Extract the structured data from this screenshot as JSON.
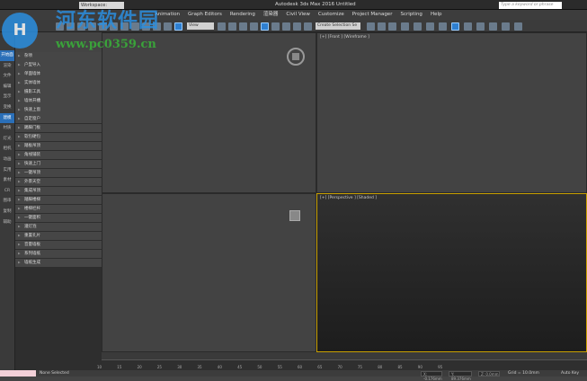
{
  "titlebar": {
    "workspace": "Workspace: Default",
    "title": "Autodesk 3ds Max 2016    Untitled",
    "search_placeholder": "Type a keyword or phrase"
  },
  "menu": [
    "Animation",
    "Graph Editors",
    "Rendering",
    "渲染器",
    "Civil View",
    "Customize",
    "Project Manager",
    "Scripting",
    "Help"
  ],
  "toolbar": {
    "view_dropdown": "View",
    "selection_set": "Create Selection Se"
  },
  "watermark": {
    "name": "河东软件园",
    "url": "www.pc0359.cn"
  },
  "vtabs": [
    "开始面",
    "渲染",
    "文件",
    "编辑",
    "显示",
    "变换",
    "建模",
    "材质",
    "灯光",
    "相机",
    "动画",
    "实用",
    "素材",
    "CR",
    "图串",
    "复制",
    "辅助"
  ],
  "vtabs_active": [
    0,
    6
  ],
  "list": [
    "杂项",
    "户型导入",
    "单面墙体",
    "实体墙体",
    "摄影工具",
    "墙体开槽",
    "快速上窗",
    "自定窗户",
    "踢脚门板",
    "软包硬包",
    "踏板吊顶",
    "角线铺装",
    "快速上门",
    "一键吊顶",
    "外景天空",
    "集成吊顶",
    "踏脚楼梯",
    "楼梯栏杆",
    "一键面积",
    "灌灯泡",
    "重置孔片",
    "音量墙板",
    "系列墙纸",
    "墙纸生成"
  ],
  "viewports": {
    "front": "[+] [Front ] [Wireframe ]",
    "perspective": "[+] [Perspective ] [Shaded ]"
  },
  "ruler_ticks": [
    "10",
    "15",
    "20",
    "25",
    "30",
    "35",
    "40",
    "45",
    "50",
    "55",
    "60",
    "65",
    "70",
    "75",
    "80",
    "85",
    "90",
    "95"
  ],
  "status": {
    "selection": "None Selected",
    "x": "X: -0.176mm",
    "y": "Y: 89.376mm",
    "z": "Z: 0.0mm",
    "grid": "Grid = 10.0mm",
    "autokey": "Auto Key"
  },
  "colors": {
    "accent": "#2f7fd0",
    "active_viewport_border": "#c9a000"
  }
}
